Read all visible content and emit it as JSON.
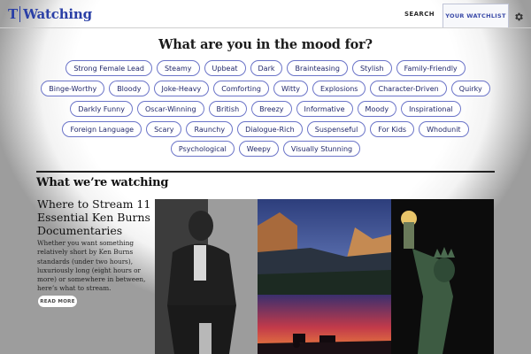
{
  "header": {
    "logo_letter": "T",
    "logo_word": "Watching",
    "nav_search": "SEARCH",
    "nav_watchlist": "YOUR WATCHLIST"
  },
  "mood": {
    "title": "What are you in the mood for?",
    "rows": [
      [
        "Strong Female Lead",
        "Steamy",
        "Upbeat",
        "Dark",
        "Brainteasing",
        "Stylish",
        "Family-Friendly"
      ],
      [
        "Binge-Worthy",
        "Bloody",
        "Joke-Heavy",
        "Comforting",
        "Witty",
        "Explosions",
        "Character-Driven",
        "Quirky"
      ],
      [
        "Darkly Funny",
        "Oscar-Winning",
        "British",
        "Breezy",
        "Informative",
        "Moody",
        "Inspirational"
      ],
      [
        "Foreign Language",
        "Scary",
        "Raunchy",
        "Dialogue-Rich",
        "Suspenseful",
        "For Kids",
        "Whodunit"
      ],
      [
        "Psychological",
        "Weepy",
        "Visually Stunning"
      ]
    ]
  },
  "watching": {
    "section_title": "What we’re watching",
    "article_title": "Where to Stream 11 Essential Ken Burns Documentaries",
    "article_summary": "Whether you want something relatively short by Ken Burns standards (under two hours), luxuriously long (eight hours or more) or somewhere in between, here’s what to stream.",
    "read_more": "READ MORE"
  },
  "icons": {
    "settings": "gear-icon"
  },
  "colors": {
    "brand_blue": "#2a3fa6",
    "tag_border": "#6b74c8",
    "tag_text": "#22286a"
  }
}
